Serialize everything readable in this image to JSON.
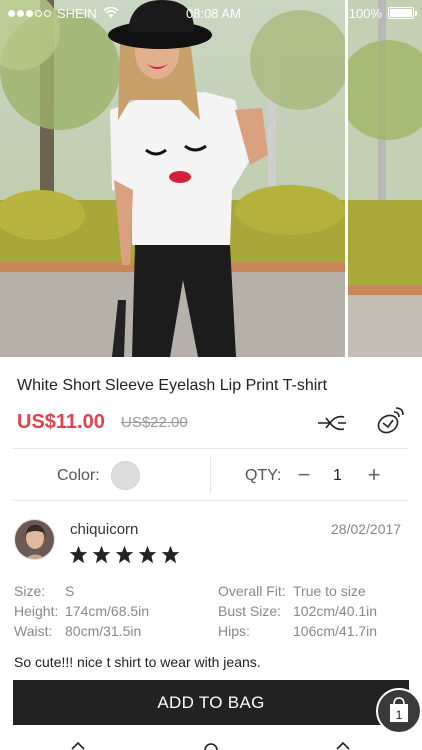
{
  "status_bar": {
    "carrier": "SHEIN",
    "time": "08:08 AM",
    "battery": "100%",
    "signal_bars_filled": 3,
    "signal_bars_total": 5
  },
  "gallery": {
    "images": [
      "model-photo",
      "model-photo-next"
    ]
  },
  "product": {
    "title": "White Short Sleeve Eyelash Lip Print T-shirt",
    "price": "US$11.00",
    "old_price": "US$22.00"
  },
  "options": {
    "color_label": "Color:",
    "qty_label": "QTY:",
    "qty_minus": "−",
    "qty_value": "1",
    "qty_plus": "+"
  },
  "review": {
    "reviewer": "chiquicorn",
    "date": "28/02/2017",
    "stars": 5,
    "size_label": "Size:",
    "size_value": "S",
    "height_label": "Height:",
    "height_value": "174cm/68.5in",
    "waist_label": "Waist:",
    "waist_value": "80cm/31.5in",
    "fit_label": "Overall Fit:",
    "fit_value": "True to size",
    "bust_label": "Bust Size:",
    "bust_value": "102cm/40.1in",
    "hips_label": "Hips:",
    "hips_value": "106cm/41.7in",
    "text": "So cute!!! nice t shirt to wear with jeans."
  },
  "actions": {
    "add_to_bag": "ADD TO BAG",
    "bag_count": "1"
  },
  "icons": {
    "share": "share-icon",
    "ar": "ar-view-icon",
    "bag": "shopping-bag-icon"
  },
  "colors": {
    "price": "#e0444f",
    "button": "#222222",
    "swatch": "#dcdcdc"
  }
}
